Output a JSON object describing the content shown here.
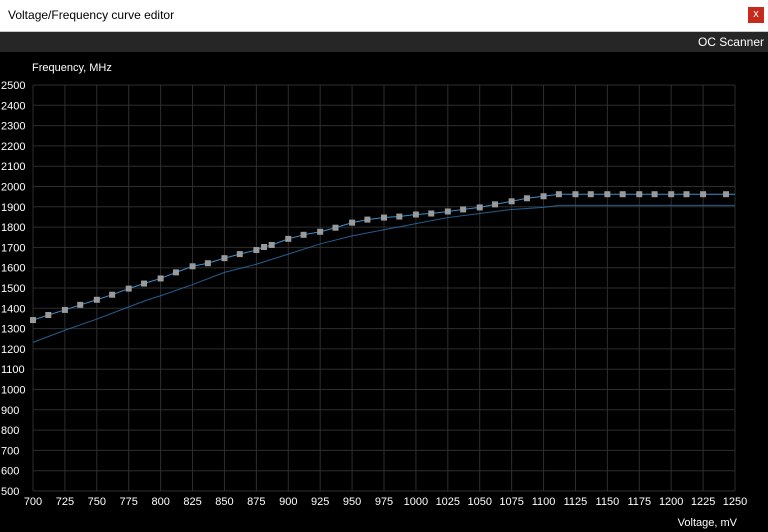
{
  "window": {
    "title": "Voltage/Frequency curve editor",
    "close_label": "x"
  },
  "toolbar": {
    "oc_scanner_label": "OC Scanner"
  },
  "colors": {
    "background": "#000000",
    "grid": "#2e2e2e",
    "curve": "#3b8fd0",
    "point": "#9a9a9a"
  },
  "chart_data": {
    "type": "line",
    "xlabel": "Voltage, mV",
    "ylabel": "Frequency, MHz",
    "xlim": [
      700,
      1250
    ],
    "ylim": [
      500,
      2500
    ],
    "x_ticks": [
      700,
      725,
      750,
      775,
      800,
      825,
      850,
      875,
      900,
      925,
      950,
      975,
      1000,
      1025,
      1050,
      1075,
      1100,
      1125,
      1150,
      1175,
      1200,
      1225,
      1250
    ],
    "y_ticks": [
      500,
      600,
      700,
      800,
      900,
      1000,
      1100,
      1200,
      1300,
      1400,
      1500,
      1600,
      1700,
      1800,
      1900,
      2000,
      2100,
      2200,
      2300,
      2400,
      2500
    ],
    "series": [
      {
        "type": "line-with-points",
        "x": [
          700,
          712,
          725,
          737,
          750,
          762,
          775,
          787,
          800,
          812,
          825,
          837,
          850,
          862,
          875,
          881,
          887,
          900,
          912,
          925,
          937,
          950,
          962,
          975,
          987,
          1000,
          1012,
          1025,
          1037,
          1050,
          1062,
          1075,
          1087,
          1100,
          1112,
          1125,
          1137,
          1150,
          1162,
          1175,
          1187,
          1200,
          1212,
          1225,
          1243
        ],
        "values": [
          1342,
          1367,
          1392,
          1417,
          1442,
          1467,
          1497,
          1522,
          1547,
          1577,
          1607,
          1622,
          1647,
          1667,
          1687,
          1702,
          1712,
          1742,
          1762,
          1777,
          1797,
          1822,
          1837,
          1847,
          1852,
          1862,
          1867,
          1877,
          1887,
          1897,
          1912,
          1927,
          1942,
          1952,
          1962,
          1962,
          1962,
          1962,
          1962,
          1962,
          1962,
          1962,
          1962,
          1962,
          1962
        ]
      },
      {
        "type": "line",
        "x": [
          700,
          725,
          750,
          775,
          790,
          800,
          825,
          850,
          875,
          900,
          925,
          950,
          975,
          1000,
          1025,
          1050,
          1075,
          1100,
          1112,
          1150,
          1200,
          1250
        ],
        "values": [
          1232,
          1292,
          1347,
          1407,
          1442,
          1462,
          1517,
          1577,
          1617,
          1667,
          1717,
          1757,
          1787,
          1817,
          1847,
          1867,
          1887,
          1897,
          1907,
          1907,
          1907,
          1907
        ]
      }
    ]
  }
}
